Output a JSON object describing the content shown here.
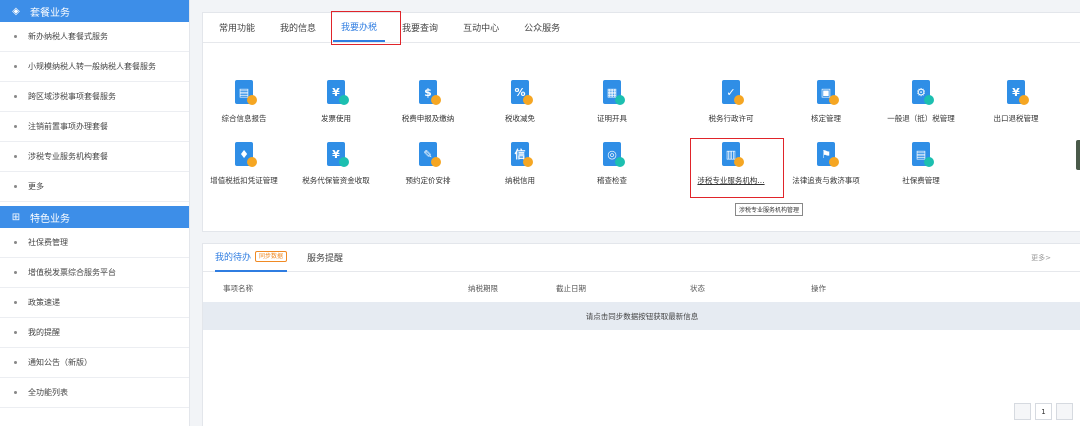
{
  "sidebar": {
    "section1": {
      "title": "套餐业务",
      "icon": "layers-icon"
    },
    "items1": [
      "新办纳税人套餐式服务",
      "小规模纳税人转一般纳税人套餐服务",
      "跨区域涉税事项套餐服务",
      "注销前置事项办理套餐",
      "涉税专业服务机构套餐",
      "更多"
    ],
    "section2": {
      "title": "特色业务",
      "icon": "grid-icon"
    },
    "items2": [
      "社保费管理",
      "增值税发票综合服务平台",
      "政策速递",
      "我的提醒",
      "通知公告（新版）",
      "全功能列表"
    ]
  },
  "tabs": [
    "常用功能",
    "我的信息",
    "我要办税",
    "我要查询",
    "互动中心",
    "公众服务"
  ],
  "active_tab": "我要办税",
  "functions": [
    {
      "label": "综合信息报告",
      "icon": "report-icon"
    },
    {
      "label": "发票使用",
      "icon": "invoice-icon"
    },
    {
      "label": "税费申报及缴纳",
      "icon": "declare-pay-icon"
    },
    {
      "label": "税收减免",
      "icon": "tax-relief-icon"
    },
    {
      "label": "证明开具",
      "icon": "certificate-icon"
    },
    {
      "label": "税务行政许可",
      "icon": "admin-permit-icon"
    },
    {
      "label": "核定管理",
      "icon": "assessment-icon"
    },
    {
      "label": "一般退（抵）税管理",
      "icon": "tax-refund-icon"
    },
    {
      "label": "出口退税管理",
      "icon": "export-refund-icon"
    },
    {
      "label": "增值税抵扣凭证管理",
      "icon": "vat-deduction-icon"
    },
    {
      "label": "税务代保管资金收取",
      "icon": "custody-fund-icon"
    },
    {
      "label": "预约定价安排",
      "icon": "pricing-icon"
    },
    {
      "label": "纳税信用",
      "icon": "credit-icon"
    },
    {
      "label": "稽查检查",
      "icon": "inspection-icon"
    },
    {
      "label": "涉税专业服务机构...",
      "icon": "service-agency-icon"
    },
    {
      "label": "法律追责与救济事项",
      "icon": "legal-icon"
    },
    {
      "label": "社保费管理",
      "icon": "social-security-icon"
    }
  ],
  "tooltip": "涉税专业服务机构管理",
  "todo": {
    "tabs": [
      "我的待办",
      "服务提醒"
    ],
    "badge": "同步数据",
    "more": "更多>",
    "columns": [
      "事项名称",
      "纳税期限",
      "截止日期",
      "状态",
      "操作"
    ],
    "empty": "请点击同步数据按钮获取最新信息",
    "page": "1"
  },
  "colors": {
    "accent": "#2f7de1",
    "header": "#3d8ee8",
    "highlight": "#e0242a"
  }
}
